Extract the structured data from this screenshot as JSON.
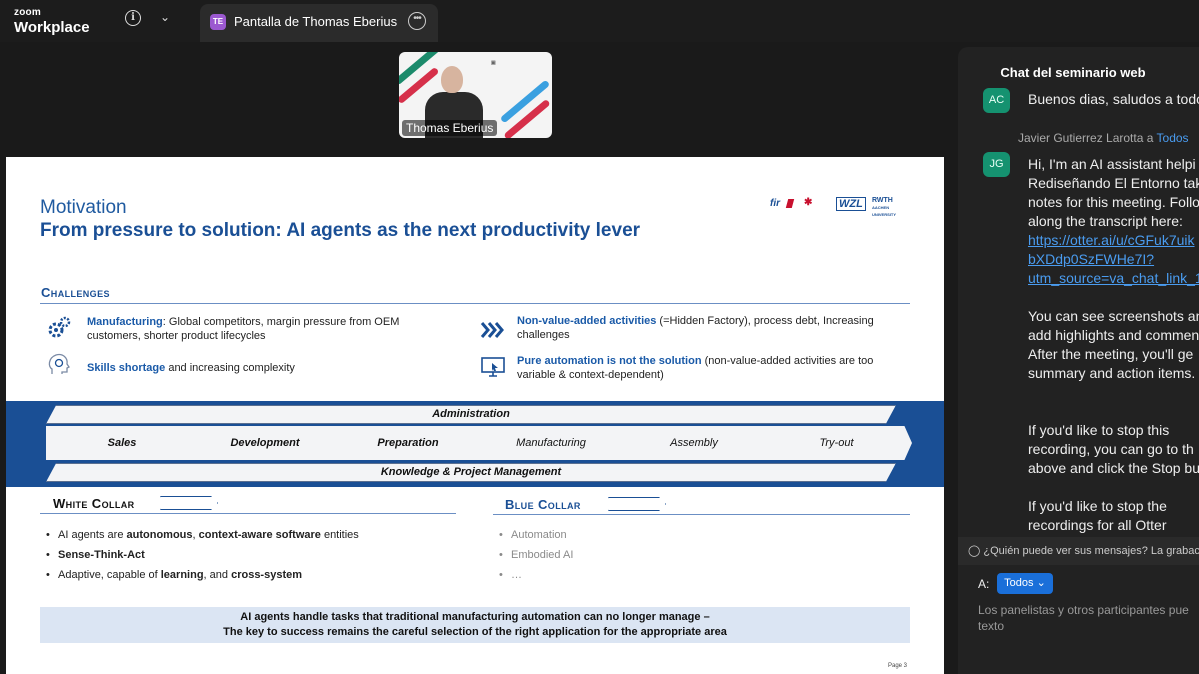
{
  "app": {
    "brand_top": "zoom",
    "brand_bottom": "Workplace"
  },
  "share_tab": {
    "initials": "TE",
    "label": "Pantalla de Thomas Eberius"
  },
  "video": {
    "name": "Thomas Eberius"
  },
  "slide": {
    "title_line1": "Motivation",
    "title_line2": "From pressure to solution: AI agents as the next productivity lever",
    "logos": {
      "fir": "fir",
      "wzl": "WZL",
      "rwth_line1": "RWTH",
      "rwth_line2": "AACHEN",
      "rwth_line3": "UNIVERSITY"
    },
    "challenges": {
      "title": "Challenges",
      "items": [
        {
          "icon": "gears-icon",
          "highlight": "Manufacturing",
          "text": ": Global competitors, margin pressure from OEM customers, shorter product lifecycles"
        },
        {
          "icon": "head-brain-icon",
          "highlight": "Skills shortage",
          "text": " and increasing complexity"
        },
        {
          "icon": "chevrons-right-icon",
          "highlight": "Non-value-added activities",
          "text": " (=Hidden Factory), process debt, Increasing challenges"
        },
        {
          "icon": "monitor-cursor-icon",
          "highlight": "Pure automation is not the solution",
          "text": " (non-value-added activities are too variable & context-dependent)"
        }
      ]
    },
    "process": {
      "top_bar": "Administration",
      "bottom_bar": "Knowledge & Project Management",
      "steps": [
        "Sales",
        "Development",
        "Preparation",
        "Manufacturing",
        "Assembly",
        "Try-out"
      ]
    },
    "white_collar": {
      "title": "White Collar",
      "bullets": [
        {
          "pre": "AI agents are ",
          "b1": "autonomous",
          "mid": ", ",
          "b2": "context-aware software",
          "post": " entities"
        },
        {
          "pre": "",
          "b1": "Sense-Think-Act",
          "mid": "",
          "b2": "",
          "post": ""
        },
        {
          "pre": "Adaptive, capable of ",
          "b1": "learning",
          "mid": ", and ",
          "b2": "cross-system",
          "post": ""
        }
      ]
    },
    "blue_collar": {
      "title": "Blue Collar",
      "bullets": [
        "Automation",
        "Embodied AI",
        "…"
      ]
    },
    "footer_line1": "AI agents handle tasks that traditional manufacturing automation can no longer manage –",
    "footer_line2": "The key to success remains the careful selection of the right application for the appropriate area",
    "page": "Page 3"
  },
  "chat": {
    "title": "Chat del seminario web",
    "msg1": {
      "avatar": "AC",
      "text": "Buenos dias, saludos a todo"
    },
    "msg2": {
      "sender": "Javier Gutierrez Larotta",
      "to_prefix": " a ",
      "to": "Todos",
      "avatar": "JG",
      "lines": [
        "Hi, I'm an AI assistant helpi",
        "Rediseñando El Entorno tak",
        "notes for this meeting. Follo",
        "along the transcript here:"
      ],
      "link_lines": [
        "https://otter.ai/u/cGFuk7uik",
        "bXDdp0SzFWHe7I?",
        "utm_source=va_chat_link_1"
      ],
      "lines2": [
        "You can see screenshots and",
        "add highlights and commen",
        "After the meeting, you'll ge",
        "summary and action items."
      ],
      "lines3": [
        "If you'd like to stop this",
        "recording, you can go to th",
        "above and click the Stop bu"
      ],
      "lines4": [
        "If you'd like to stop the",
        "recordings for all Otter"
      ]
    },
    "notice": "¿Quién puede ver sus mensajes? La grabac",
    "to_label": "A:",
    "to_button": "Todos",
    "placeholder": "Los panelistas y otros participantes pue texto"
  },
  "colors": {
    "accent": "#1a4f95",
    "chat_link": "#4a9cf0",
    "avatar": "#159270"
  }
}
